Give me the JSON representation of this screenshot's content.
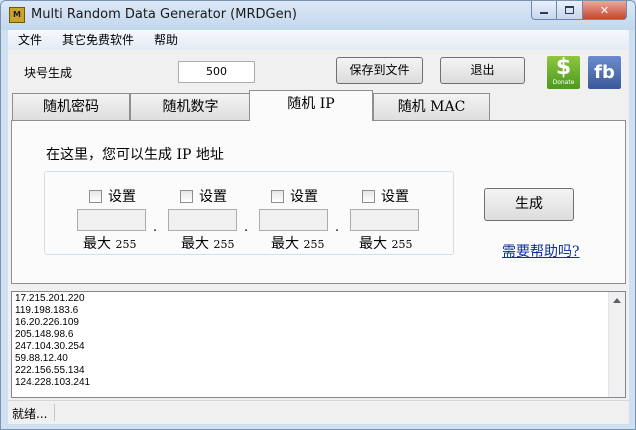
{
  "window": {
    "title": "Multi Random Data Generator (MRDGen)",
    "app_icon_text": "M"
  },
  "menu": {
    "items": [
      "文件",
      "其它免费软件",
      "帮助"
    ]
  },
  "toolbar": {
    "block_label": "块号生成",
    "block_value": "500",
    "save_label": "保存到文件",
    "exit_label": "退出",
    "donate_symbol": "$",
    "donate_text": "Donate",
    "fb_text": "fb"
  },
  "tabs": [
    {
      "label": "随机密码",
      "active": false
    },
    {
      "label": "随机数字",
      "active": false
    },
    {
      "label": "随机 IP",
      "active": true
    },
    {
      "label": "随机 MAC",
      "active": false
    }
  ],
  "ip_panel": {
    "caption": "在这里，您可以生成 IP 地址",
    "set_label": "设置",
    "max_prefix": "最大",
    "max_value": "255",
    "separator": ".",
    "generate_label": "生成",
    "help_link": "需要帮助吗?"
  },
  "output": {
    "lines": [
      "17.215.201.220",
      "119.198.183.6",
      "16.20.226.109",
      "205.148.98.6",
      "247.104.30.254",
      "59.88.12.40",
      "222.156.55.134",
      "124.228.103.241"
    ]
  },
  "status": {
    "text": "就绪..."
  }
}
